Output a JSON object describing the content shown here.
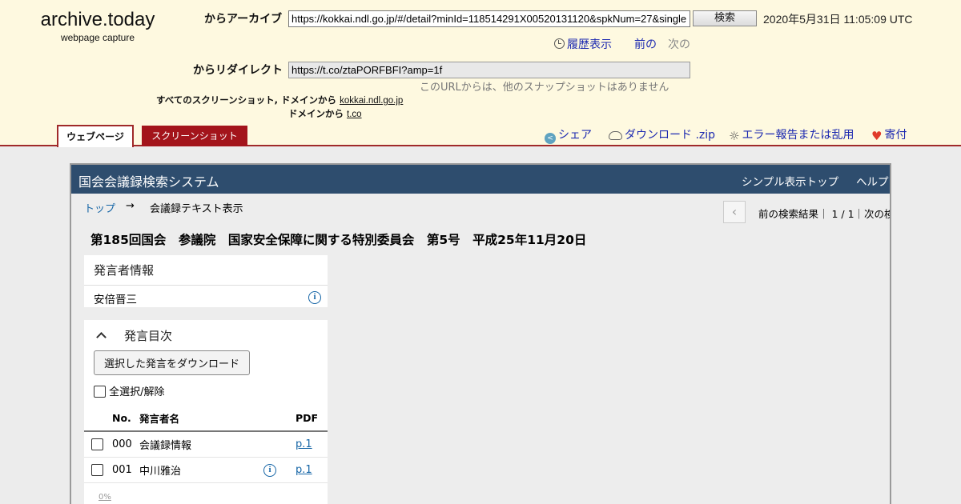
{
  "archive": {
    "logo_name": "archive.today",
    "logo_sub": "webpage capture",
    "archive_label": "からアーカイブ",
    "archive_url": "https://kokkai.ndl.go.jp/#/detail?minId=118514291X00520131120&spkNum=27&single",
    "search_button": "検索",
    "datetime": "2020年5月31日 11:05:09 UTC",
    "history_label": "履歴表示",
    "prev_label": "前の",
    "next_label": "次の",
    "redirect_label": "からリダイレクト",
    "redirect_url": "https://t.co/ztaPORFBFI?amp=1f",
    "no_snapshots": "このURLからは、他のスナップショットはありません",
    "all_screens_label": "すべてのスクリーンショット,",
    "domain_label_1": "ドメインから",
    "domain_link_1": "kokkai.ndl.go.jp",
    "domain_label_2": "ドメインから",
    "domain_link_2": "t.co",
    "tab_webpage": "ウェブページ",
    "tab_screenshot": "スクリーンショット",
    "share": "シェア",
    "download": "ダウンロード .zip",
    "report": "エラー報告または乱用",
    "donate": "寄付",
    "colors": {
      "header_bg": "#fef9e0",
      "accent_red": "#a02a2a",
      "link_blue": "#1c29b0"
    }
  },
  "site": {
    "title": "国会会議録検索システム",
    "nav_simple_top": "シンプル表示トップ",
    "nav_help": "ヘルプ",
    "crumb_top": "トップ",
    "crumb_arrow": "→",
    "crumb_current": "会議録テキスト表示",
    "pager_text": "前の検索結果｜ 1 / 1｜次の検",
    "meeting_title": "第185回国会　参議院　国家安全保障に関する特別委員会　第5号　平成25年11月20日",
    "speaker_panel_title": "発言者情報",
    "speaker_name": "安倍晋三",
    "toc_title": "発言目次",
    "download_selected": "選択した発言をダウンロード",
    "select_all": "全選択/解除",
    "col_no": "No.",
    "col_speaker": "発言者名",
    "col_pdf": "PDF",
    "rows": [
      {
        "no": "000",
        "name": "会議録情報",
        "has_info": false,
        "pdf": "p.1"
      },
      {
        "no": "001",
        "name": "中川雅治",
        "has_info": true,
        "pdf": "p.1"
      }
    ],
    "progress_label": "0%",
    "colors": {
      "bar_bg": "#2e4d6e",
      "link": "#1565a6"
    }
  }
}
